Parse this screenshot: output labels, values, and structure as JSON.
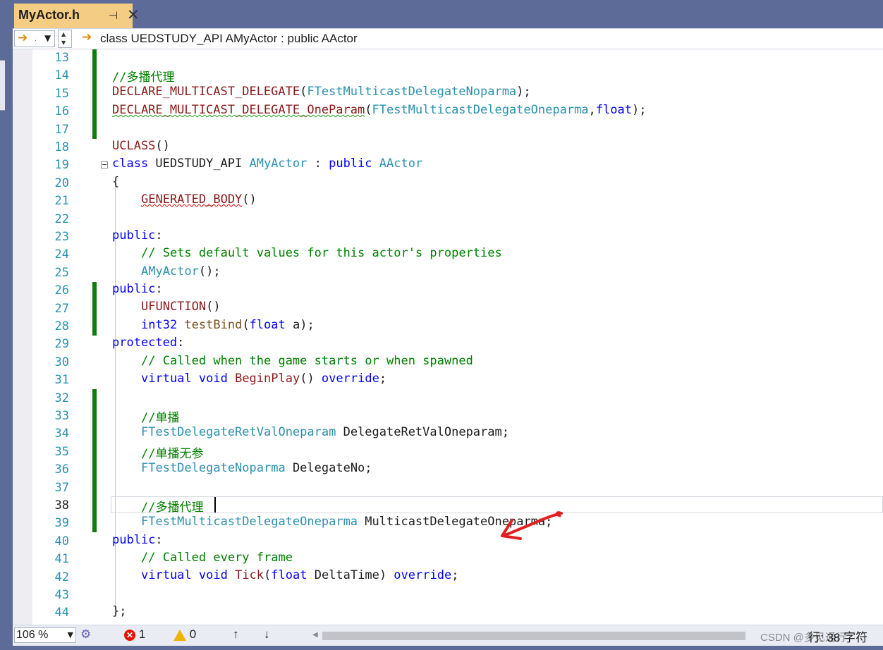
{
  "tab": {
    "title": "MyActor.h",
    "pin_icon": "pin-icon",
    "close_icon": "close-icon"
  },
  "navbar": {
    "left_value": ".",
    "scope": "class UEDSTUDY_API AMyActor : public AActor"
  },
  "editor": {
    "current_line": "38",
    "lines": [
      {
        "n": "13"
      },
      {
        "n": "14"
      },
      {
        "n": "15"
      },
      {
        "n": "16"
      },
      {
        "n": "17"
      },
      {
        "n": "18"
      },
      {
        "n": "19"
      },
      {
        "n": "20"
      },
      {
        "n": "21"
      },
      {
        "n": "22"
      },
      {
        "n": "23"
      },
      {
        "n": "24"
      },
      {
        "n": "25"
      },
      {
        "n": "26"
      },
      {
        "n": "27"
      },
      {
        "n": "28"
      },
      {
        "n": "29"
      },
      {
        "n": "30"
      },
      {
        "n": "31"
      },
      {
        "n": "32"
      },
      {
        "n": "33"
      },
      {
        "n": "34"
      },
      {
        "n": "35"
      },
      {
        "n": "36"
      },
      {
        "n": "37"
      },
      {
        "n": "38"
      },
      {
        "n": "39"
      },
      {
        "n": "40"
      },
      {
        "n": "41"
      },
      {
        "n": "42"
      },
      {
        "n": "43"
      },
      {
        "n": "44"
      }
    ],
    "code": {
      "l14": "//多播代理",
      "l15_macro": "DECLARE_MULTICAST_DELEGATE",
      "l15_open": "(",
      "l15_type": "FTestMulticastDelegateNoparma",
      "l15_close": ");",
      "l16_macro": "DECLARE_MULTICAST_DELEGATE_OneParam",
      "l16_open": "(",
      "l16_type": "FTestMulticastDelegateOneparma",
      "l16_comma": ",",
      "l16_kw": "float",
      "l16_close": ");",
      "l18_macro": "UCLASS",
      "l18_paren": "()",
      "l19_kw1": "class",
      "l19_api": " UEDSTUDY_API ",
      "l19_type1": "AMyActor",
      "l19_colon": " : ",
      "l19_kw2": "public",
      "l19_space": " ",
      "l19_type2": "AActor",
      "l20": "{",
      "l21_macro": "GENERATED_BODY",
      "l21_paren": "()",
      "l23_kw": "public",
      "l23_colon": ":",
      "l24": "// Sets default values for this actor's properties",
      "l25_type": "AMyActor",
      "l25_rest": "();",
      "l26_kw": "public",
      "l26_colon": ":",
      "l27_macro": "UFUNCTION",
      "l27_paren": "()",
      "l28_kw1": "int32",
      "l28_fn": " testBind",
      "l28_open": "(",
      "l28_kw2": "float",
      "l28_rest": " a);",
      "l29_kw": "protected",
      "l29_colon": ":",
      "l30": "// Called when the game starts or when spawned",
      "l31_kw1": "virtual",
      "l31_kw2": " void",
      "l31_fn": " BeginPlay",
      "l31_paren": "() ",
      "l31_kw3": "override",
      "l31_semi": ";",
      "l33": "//单播",
      "l34_type": "FTestDelegateRetValOneparam",
      "l34_rest": " DelegateRetValOneparam;",
      "l35": "//单播无参",
      "l36_type": "FTestDelegateNoparma",
      "l36_rest": " DelegateNo;",
      "l38": "//多播代理",
      "l39_type": "FTestMulticastDelegateOneparma",
      "l39_rest": " MulticastDelegateOneparma;",
      "l40_kw": "public",
      "l40_colon": ":",
      "l41": "// Called every frame",
      "l42_kw1": "virtual",
      "l42_kw2": " void",
      "l42_fn": " Tick",
      "l42_open": "(",
      "l42_kw3": "float",
      "l42_rest": " DeltaTime) ",
      "l42_kw4": "override",
      "l42_semi": ";",
      "l44": "};"
    }
  },
  "statusbar": {
    "zoom": "106 %",
    "errors": "1",
    "warnings": "0",
    "up": "↑",
    "down": "↓",
    "row": "行: 38",
    "col": "字符",
    "watermark": "CSDN @多见通行"
  },
  "colors": {
    "tab": "#f5cc84",
    "frame": "#5d6b99",
    "change_bar": "#107c10",
    "line_number": "#2b91af",
    "annotation": "#e02020"
  }
}
